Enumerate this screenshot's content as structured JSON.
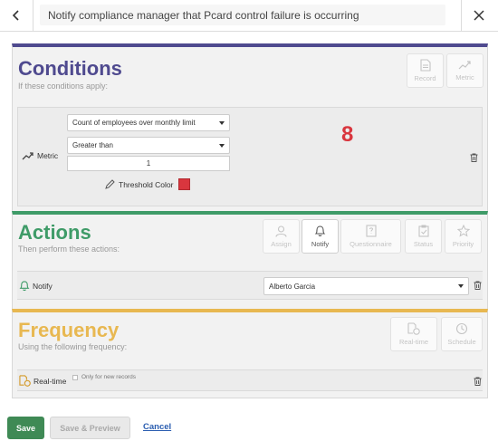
{
  "header": {
    "title": "Notify compliance manager that Pcard control failure is occurring"
  },
  "conditions": {
    "title": "Conditions",
    "subtitle": "If these conditions apply:",
    "color": "#4f4a8f",
    "toolbar": [
      {
        "label": "Record",
        "icon": "document-icon"
      },
      {
        "label": "Metric",
        "icon": "trend-icon"
      }
    ],
    "metric_label": "Metric",
    "metric_select": "Count of employees over monthly limit",
    "operator_select": "Greater than",
    "threshold_value": "1",
    "metric_value": "8",
    "threshold_color_label": "Threshold Color",
    "threshold_color": "#d9363e"
  },
  "actions": {
    "title": "Actions",
    "subtitle": "Then perform these actions:",
    "color": "#3f9b68",
    "toolbar": [
      {
        "label": "Assign",
        "icon": "person-icon"
      },
      {
        "label": "Notify",
        "icon": "bell-icon"
      },
      {
        "label": "Questionnaire",
        "icon": "questionnaire-icon"
      },
      {
        "label": "Status",
        "icon": "status-icon"
      },
      {
        "label": "Priority",
        "icon": "star-icon"
      }
    ],
    "notify_label": "Notify",
    "notify_select": "Alberto Garcia"
  },
  "frequency": {
    "title": "Frequency",
    "subtitle": "Using the following frequency:",
    "color": "#e8b851",
    "toolbar": [
      {
        "label": "Real-time",
        "icon": "realtime-icon"
      },
      {
        "label": "Schedule",
        "icon": "clock-icon"
      }
    ],
    "realtime_label": "Real-time",
    "only_new_label": "Only for new records"
  },
  "footer": {
    "save": "Save",
    "save_preview": "Save & Preview",
    "cancel": "Cancel"
  }
}
